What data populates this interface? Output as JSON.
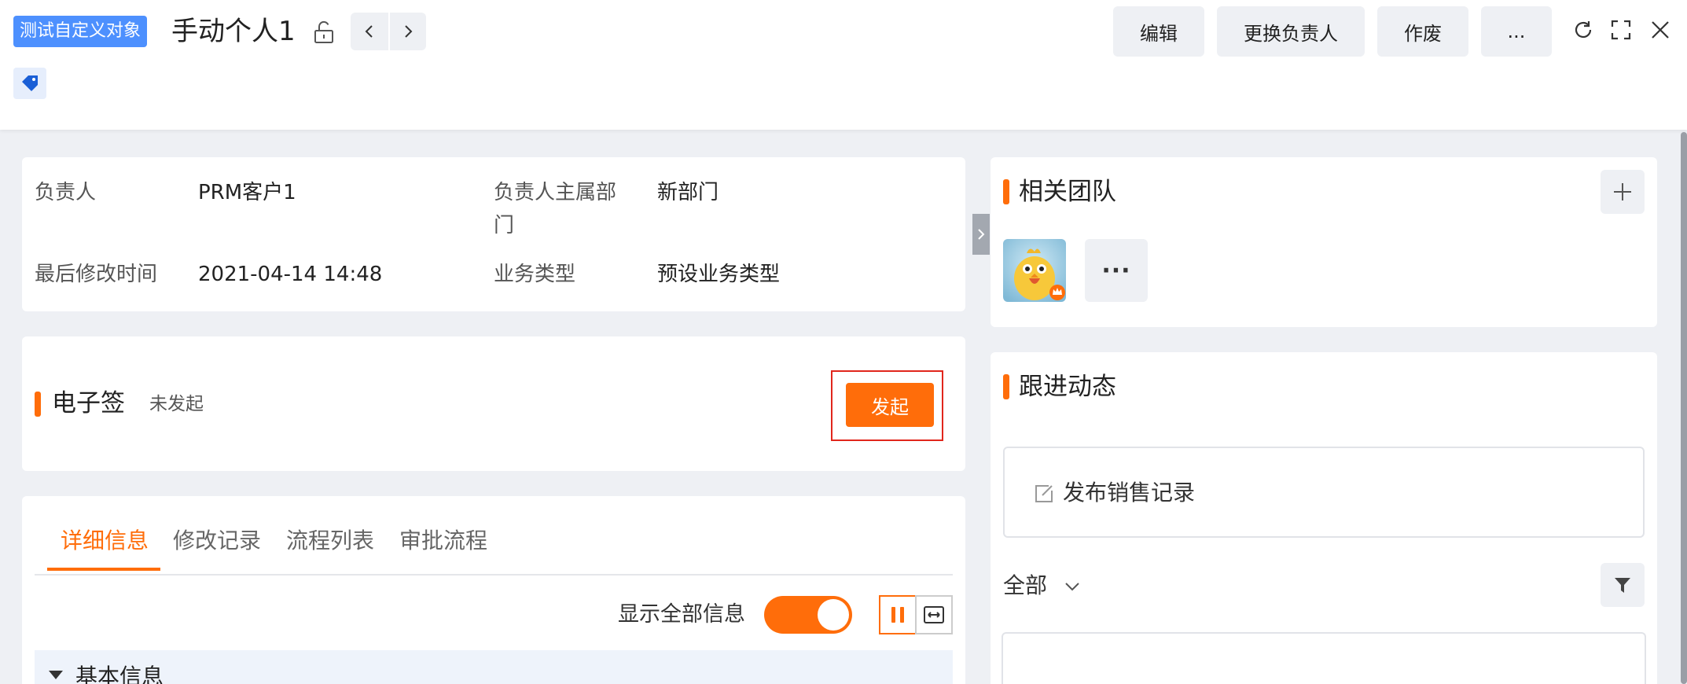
{
  "header": {
    "object_badge": "测试自定义对象",
    "record_title": "手动个人1",
    "lock_icon": "unlock-icon",
    "prev_icon": "chevron-left-icon",
    "next_icon": "chevron-right-icon",
    "tag_icon": "tag-icon",
    "buttons": {
      "edit": "编辑",
      "change_owner": "更换负责人",
      "void": "作废",
      "more": "..."
    },
    "window_icons": [
      "refresh-icon",
      "fullscreen-icon",
      "close-icon"
    ]
  },
  "info": {
    "owner_label": "负责人",
    "owner_value": "PRM客户1",
    "dept_label_1": "负责人主属部",
    "dept_label_2": "门",
    "dept_value": "新部门",
    "modified_label": "最后修改时间",
    "modified_value": "2021-04-14 14:48",
    "biztype_label": "业务类型",
    "biztype_value": "预设业务类型"
  },
  "esign": {
    "title": "电子签",
    "status": "未发起",
    "launch_button": "发起"
  },
  "tabs": [
    {
      "label": "详细信息",
      "active": true
    },
    {
      "label": "修改记录",
      "active": false
    },
    {
      "label": "流程列表",
      "active": false
    },
    {
      "label": "审批流程",
      "active": false
    }
  ],
  "detail": {
    "show_all_label": "显示全部信息",
    "show_all_on": true,
    "group_title": "基本信息"
  },
  "team": {
    "title": "相关团队",
    "add_icon": "plus-icon",
    "more_label": "···"
  },
  "followup": {
    "title": "跟进动态",
    "publish_label": "发布销售记录",
    "filter_label": "全部",
    "filter_icon": "funnel-icon"
  },
  "colors": {
    "accent": "#ff6d0a",
    "badge": "#4d90fe",
    "highlight_border": "#e1261c"
  }
}
